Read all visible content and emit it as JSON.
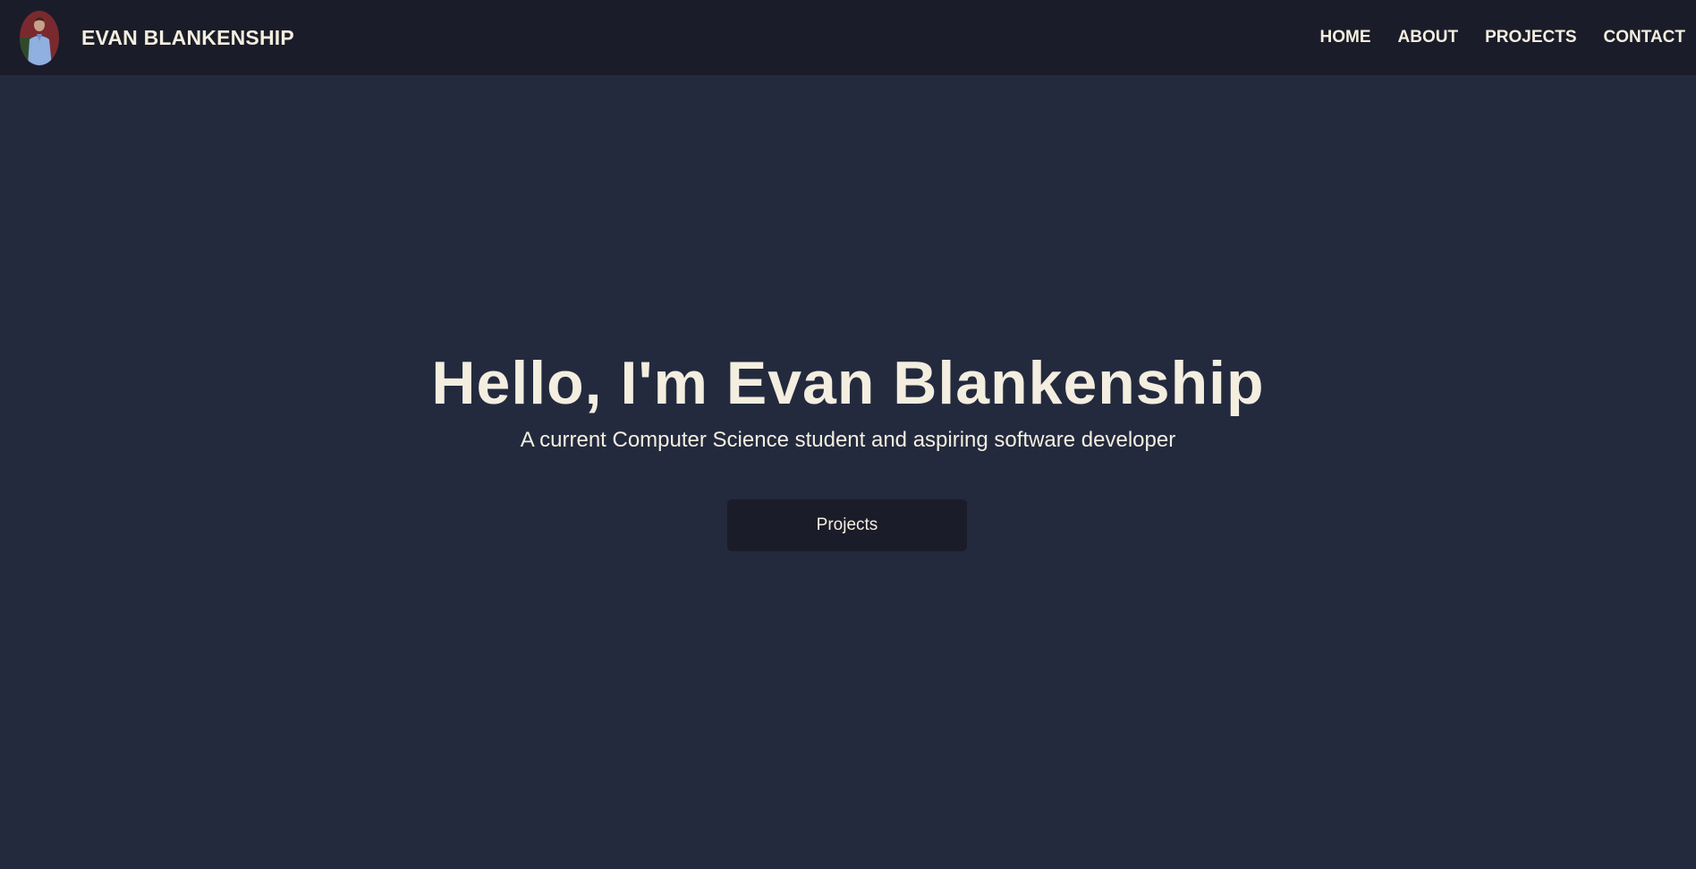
{
  "nav": {
    "brand_name": "EVAN BLANKENSHIP",
    "avatar_alt": "Evan Blankenship profile photo",
    "links": [
      {
        "label": "HOME"
      },
      {
        "label": "ABOUT"
      },
      {
        "label": "PROJECTS"
      },
      {
        "label": "CONTACT"
      }
    ]
  },
  "hero": {
    "title": "Hello, I'm Evan Blankenship",
    "subtitle": "A current Computer Science student and aspiring software developer",
    "button_label": "Projects"
  },
  "colors": {
    "page_background": "#232a3e",
    "navbar_background": "#1b1c29",
    "text": "#f3eedf",
    "button_background": "#1b1c29"
  }
}
